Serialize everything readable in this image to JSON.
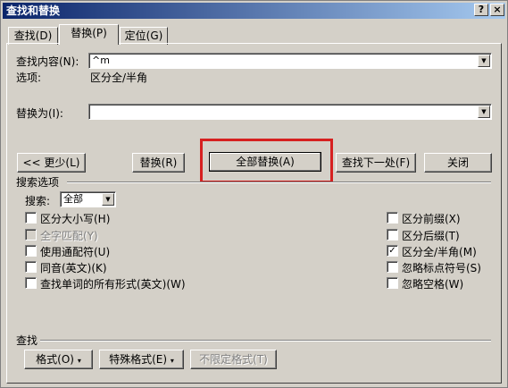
{
  "window": {
    "title": "查找和替换",
    "help_btn": "?",
    "close_btn": "×"
  },
  "tabs": [
    {
      "label": "查找(D)"
    },
    {
      "label": "替换(P)"
    },
    {
      "label": "定位(G)"
    }
  ],
  "find": {
    "label": "查找内容(N):",
    "value": "^m",
    "options_label": "选项:",
    "options_value": "区分全/半角"
  },
  "replace": {
    "label": "替换为(I):",
    "value": ""
  },
  "buttons": {
    "less": "<< 更少(L)",
    "replace": "替换(R)",
    "replace_all": "全部替换(A)",
    "find_next": "查找下一处(F)",
    "close": "关闭"
  },
  "search_options": {
    "heading": "搜索选项",
    "search_label": "搜索:",
    "search_value": "全部",
    "left": [
      {
        "label": "区分大小写(H)",
        "checked": false,
        "disabled": false
      },
      {
        "label": "全字匹配(Y)",
        "checked": false,
        "disabled": true
      },
      {
        "label": "使用通配符(U)",
        "checked": false,
        "disabled": false
      },
      {
        "label": "同音(英文)(K)",
        "checked": false,
        "disabled": false
      },
      {
        "label": "查找单词的所有形式(英文)(W)",
        "checked": false,
        "disabled": false
      }
    ],
    "right": [
      {
        "label": "区分前缀(X)",
        "checked": false
      },
      {
        "label": "区分后缀(T)",
        "checked": false
      },
      {
        "label": "区分全/半角(M)",
        "checked": true
      },
      {
        "label": "忽略标点符号(S)",
        "checked": false
      },
      {
        "label": "忽略空格(W)",
        "checked": false
      }
    ]
  },
  "footer": {
    "heading": "查找",
    "format": "格式(O)",
    "special": "特殊格式(E)",
    "no_format": "不限定格式(T)"
  },
  "colors": {
    "highlight": "#d62020",
    "title_bar": "#0a246a",
    "face": "#d4d0c8"
  }
}
